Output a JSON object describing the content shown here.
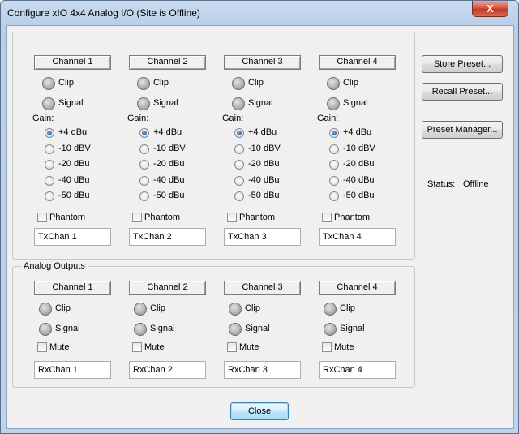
{
  "window": {
    "title": "Configure xIO 4x4 Analog I/O (Site is Offline)",
    "close_glyph": "X"
  },
  "inputs": {
    "gain_label": "Gain:",
    "clip_label": "Clip",
    "signal_label": "Signal",
    "phantom_label": "Phantom",
    "gain_options": [
      "+4 dBu",
      "-10 dBV",
      "-20 dBu",
      "-40 dBu",
      "-50 dBu"
    ],
    "channels": [
      {
        "name": "Channel 1",
        "selected_gain": "+4 dBu",
        "phantom": false,
        "tx_name": "TxChan 1"
      },
      {
        "name": "Channel 2",
        "selected_gain": "+4 dBu",
        "phantom": false,
        "tx_name": "TxChan 2"
      },
      {
        "name": "Channel 3",
        "selected_gain": "+4 dBu",
        "phantom": false,
        "tx_name": "TxChan 3"
      },
      {
        "name": "Channel 4",
        "selected_gain": "+4 dBu",
        "phantom": false,
        "tx_name": "TxChan 4"
      }
    ]
  },
  "outputs": {
    "group_label": "Analog Outputs",
    "clip_label": "Clip",
    "signal_label": "Signal",
    "mute_label": "Mute",
    "channels": [
      {
        "name": "Channel 1",
        "mute": false,
        "rx_name": "RxChan 1"
      },
      {
        "name": "Channel 2",
        "mute": false,
        "rx_name": "RxChan 2"
      },
      {
        "name": "Channel 3",
        "mute": false,
        "rx_name": "RxChan 3"
      },
      {
        "name": "Channel 4",
        "mute": false,
        "rx_name": "RxChan 4"
      }
    ]
  },
  "side": {
    "store_preset": "Store Preset...",
    "recall_preset": "Recall Preset...",
    "preset_manager": "Preset Manager...",
    "status_label": "Status:",
    "status_value": "Offline"
  },
  "footer": {
    "close_label": "Close"
  }
}
